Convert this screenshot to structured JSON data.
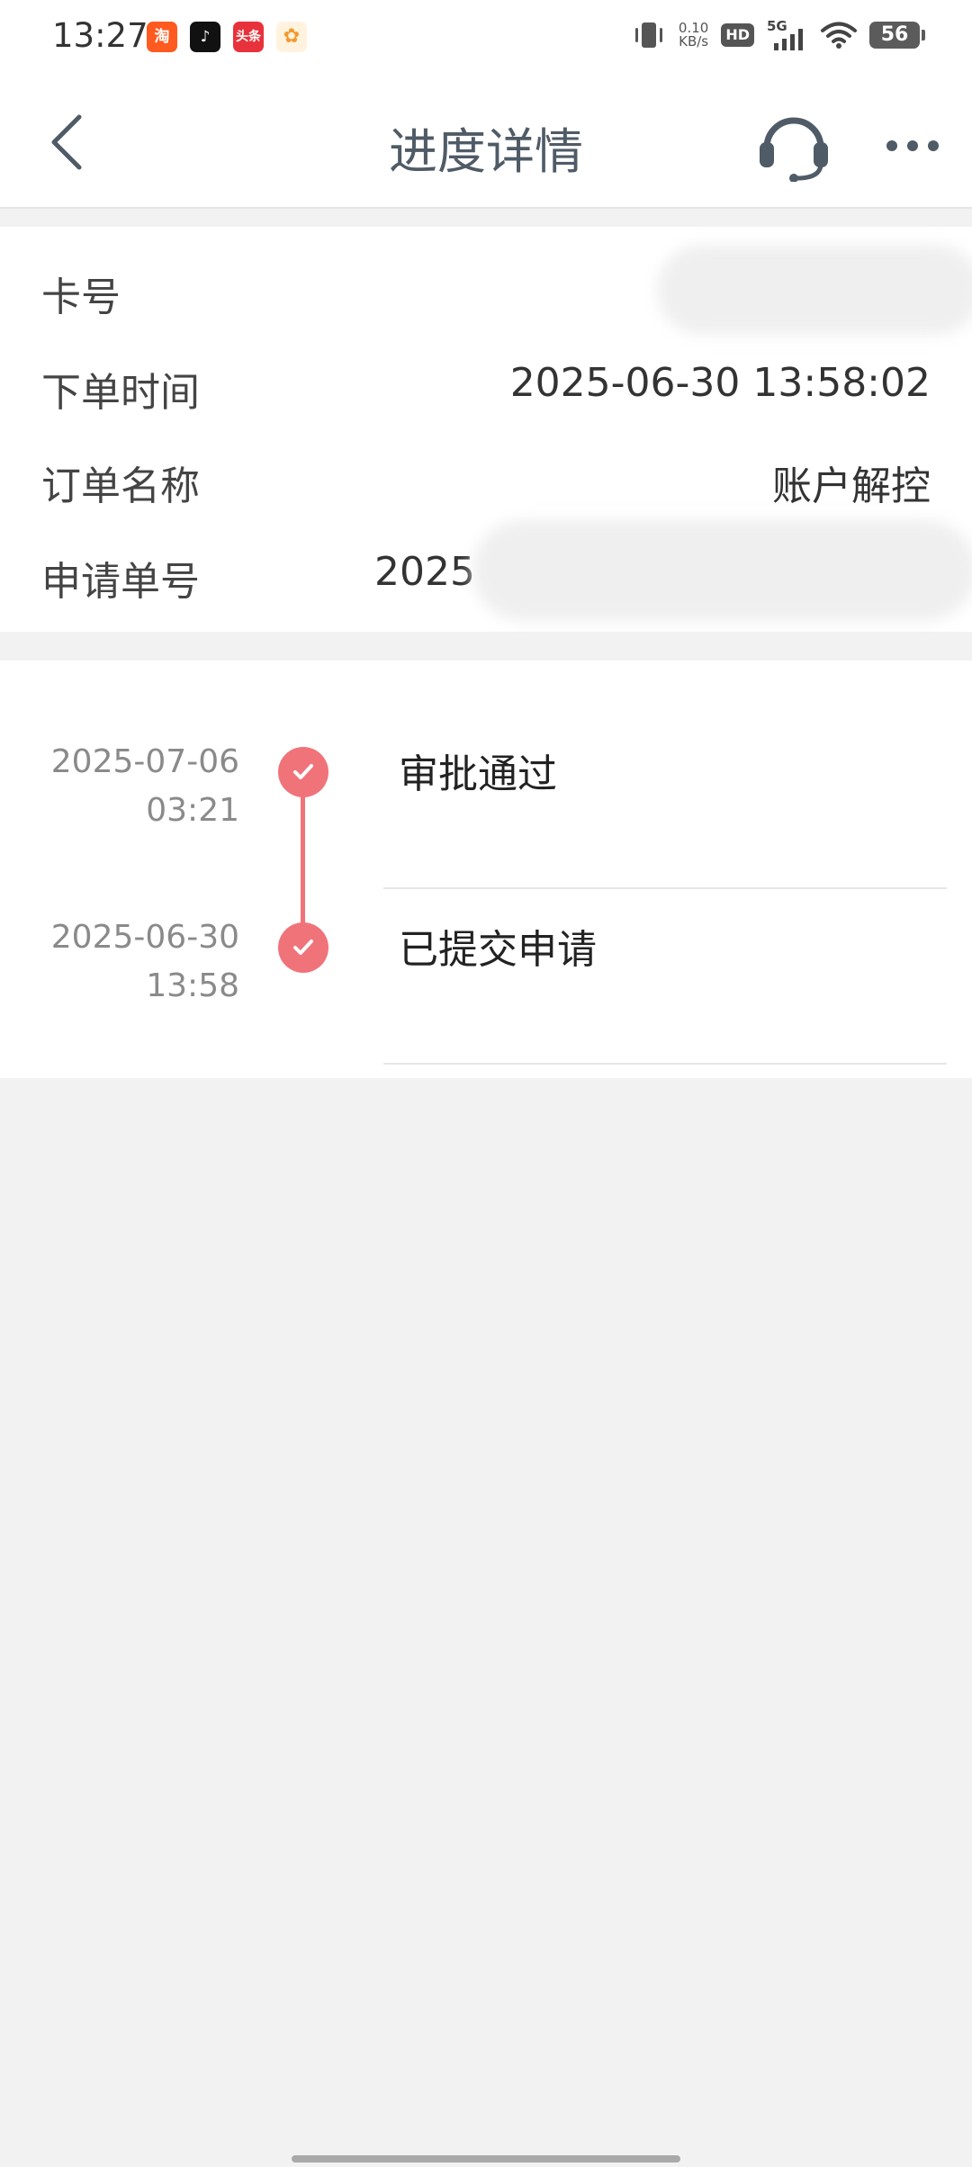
{
  "status_bar": {
    "time": "13:27",
    "notification_icons": [
      {
        "name": "taobao-app-icon",
        "glyph": "淘"
      },
      {
        "name": "douyin-app-icon",
        "glyph": "♪"
      },
      {
        "name": "toutiao-app-icon",
        "glyph": "头条"
      },
      {
        "name": "misc-app-icon",
        "glyph": "✿"
      }
    ],
    "net_speed_value": "0.10",
    "net_speed_unit": "KB/s",
    "hd_label": "HD",
    "network_label": "5G",
    "battery_level": "56"
  },
  "nav": {
    "title": "进度详情"
  },
  "info": {
    "card_number_label": "卡号",
    "order_time_label": "下单时间",
    "order_time_value": "2025-06-30 13:58:02",
    "order_name_label": "订单名称",
    "order_name_value": "账户解控",
    "application_no_label": "申请单号",
    "application_no_value": "2025"
  },
  "timeline": [
    {
      "date": "2025-07-06",
      "time": "03:21",
      "title": "审批通过",
      "status": "done"
    },
    {
      "date": "2025-06-30",
      "time": "13:58",
      "title": "已提交申请",
      "status": "done"
    }
  ],
  "colors": {
    "accent": "#f0737a",
    "nav_text": "#4f5b66",
    "background": "#f2f2f2"
  }
}
